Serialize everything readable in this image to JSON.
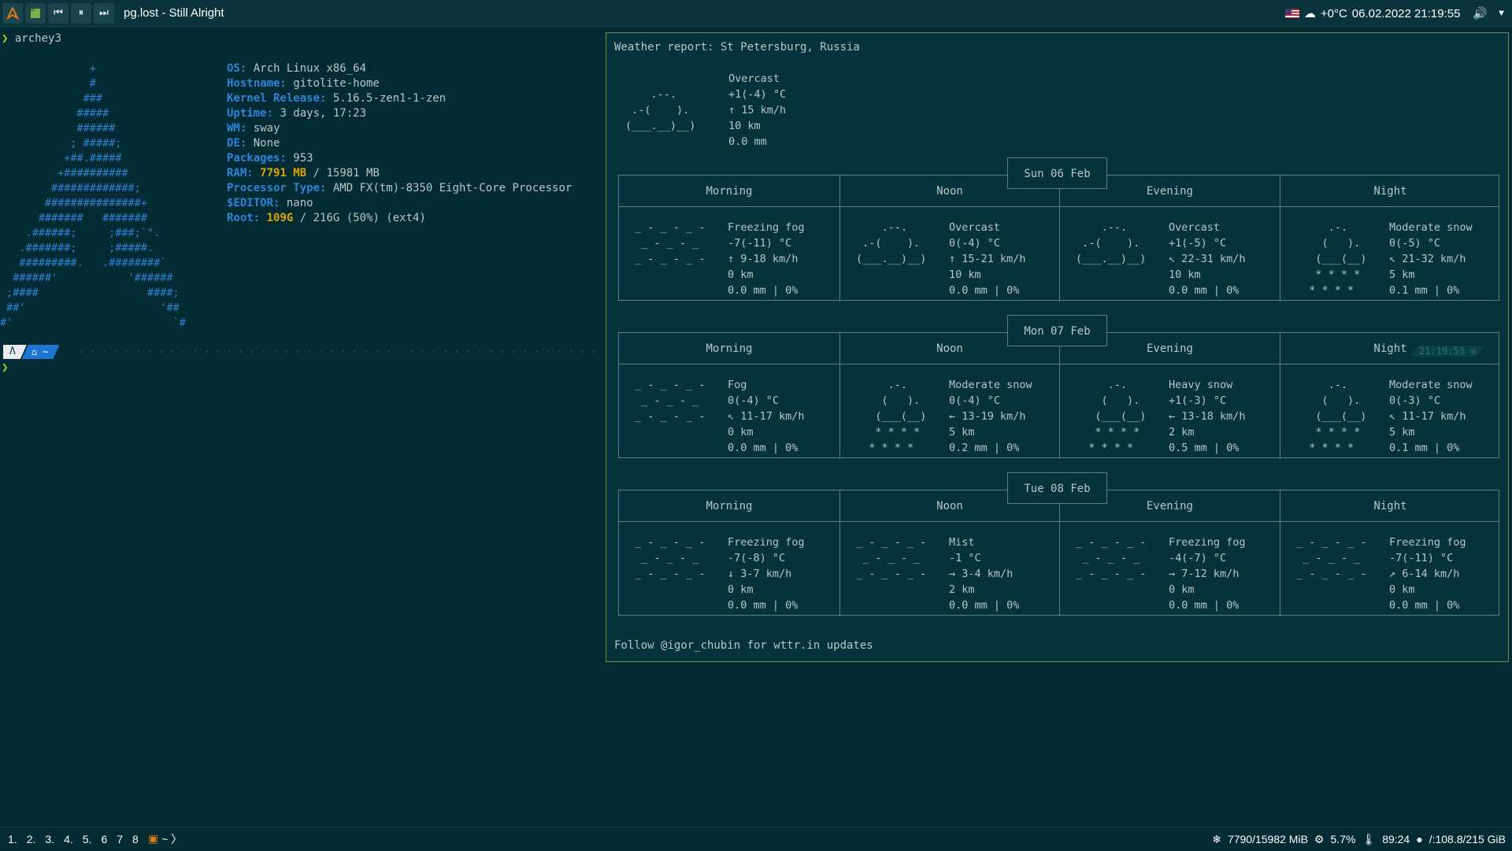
{
  "topbar": {
    "controls": [
      "prev",
      "pause",
      "next"
    ],
    "track": "pg.lost - Still Alright",
    "weather": "+0°C",
    "datetime": "06.02.2022 21:19:55",
    "icons": [
      "arch-icon",
      "file-manager-icon",
      "prev-icon",
      "pause-icon",
      "next-icon",
      "flag-icon",
      "weather-icon",
      "volume-icon",
      "chevron-down-icon"
    ]
  },
  "terminal": {
    "prompt": "❯",
    "command": "archey3",
    "info": [
      {
        "key": "OS:",
        "value": " Arch Linux x86_64"
      },
      {
        "key": "Hostname:",
        "value": " gitolite-home"
      },
      {
        "key": "Kernel Release:",
        "value": " 5.16.5-zen1-1-zen"
      },
      {
        "key": "Uptime:",
        "value": " 3 days, 17:23"
      },
      {
        "key": "WM:",
        "value": " sway"
      },
      {
        "key": "DE:",
        "value": " None"
      },
      {
        "key": "Packages:",
        "value": " 953"
      }
    ],
    "ram_key": "RAM:",
    "ram_used": "7791 MB",
    "ram_total": " / 15981 MB",
    "processor_key": "Processor Type:",
    "processor": " AMD FX(tm)-8350 Eight-Core Processor",
    "editor_key": "$EDITOR:",
    "editor": " nano",
    "root_key": "Root:",
    "root_used": "109G",
    "root_rest": " / 216G (50%) (ext4)",
    "logo": "              +\n              #\n             ###\n            #####\n            ######\n           ; #####;\n          +##.#####\n         +##########\n        #############;\n       ###############+\n      #######   #######\n    .######;     ;###;`\".\n   .#######;     ;#####.\n   #########.   .########`\n  ######'           '######\n ;####                 ####;\n ##'                     '##\n#'                         `#",
    "prompt_seg1": "Λ",
    "prompt_seg2": "⌂ ~",
    "cursor": "❯",
    "ghost_time": "21:19:53 ⊙"
  },
  "weather": {
    "title": "Weather report: St Petersburg, Russia",
    "current": {
      "art": "    .--.\n .-(    ).\n(___.__)__)",
      "lines": "Overcast\n+1(-4) °C\n↑ 15 km/h\n10 km\n0.0 mm"
    },
    "columns": [
      "Morning",
      "Noon",
      "Evening",
      "Night"
    ],
    "days": [
      {
        "label": "Sun 06 Feb",
        "cells": [
          {
            "art": "_ - _ - _ -\n _ - _ - _\n_ - _ - _ -",
            "text": "Freezing fog\n-7(-11) °C\n↑ 9-18 km/h\n0 km\n0.0 mm | 0%"
          },
          {
            "art": "    .--.\n .-(    ).\n(___.__)__)",
            "text": "Overcast\n0(-4) °C\n↑ 15-21 km/h\n10 km\n0.0 mm | 0%"
          },
          {
            "art": "    .--.\n .-(    ).\n(___.__)__)",
            "text": "Overcast\n+1(-5) °C\n↖ 22-31 km/h\n10 km\n0.0 mm | 0%"
          },
          {
            "art": "     .-.\n    (   ).\n   (___(__)\n   * * * *\n  * * * *",
            "text": "Moderate snow\n0(-5) °C\n↖ 21-32 km/h\n5 km\n0.1 mm | 0%"
          }
        ]
      },
      {
        "label": "Mon 07 Feb",
        "cells": [
          {
            "art": "_ - _ - _ -\n _ - _ - _\n_ - _ - _ -",
            "text": "Fog\n0(-4) °C\n↖ 11-17 km/h\n0 km\n0.0 mm | 0%"
          },
          {
            "art": "     .-.\n    (   ).\n   (___(__)\n   * * * *\n  * * * *",
            "text": "Moderate snow\n0(-4) °C\n← 13-19 km/h\n5 km\n0.2 mm | 0%"
          },
          {
            "art": "     .-.\n    (   ).\n   (___(__)\n   * * * *\n  * * * *",
            "text": "Heavy snow\n+1(-3) °C\n← 13-18 km/h\n2 km\n0.5 mm | 0%"
          },
          {
            "art": "     .-.\n    (   ).\n   (___(__)\n   * * * *\n  * * * *",
            "text": "Moderate snow\n0(-3) °C\n↖ 11-17 km/h\n5 km\n0.1 mm | 0%"
          }
        ]
      },
      {
        "label": "Tue 08 Feb",
        "cells": [
          {
            "art": "_ - _ - _ -\n _ - _ - _\n_ - _ - _ -",
            "text": "Freezing fog\n-7(-8) °C\n↓ 3-7 km/h\n0 km\n0.0 mm | 0%"
          },
          {
            "art": "_ - _ - _ -\n _ - _ - _\n_ - _ - _ -",
            "text": "Mist\n-1 °C\n→ 3-4 km/h\n2 km\n0.0 mm | 0%"
          },
          {
            "art": "_ - _ - _ -\n _ - _ - _\n_ - _ - _ -",
            "text": "Freezing fog\n-4(-7) °C\n→ 7-12 km/h\n0 km\n0.0 mm | 0%"
          },
          {
            "art": "_ - _ - _ -\n _ - _ - _\n_ - _ - _ -",
            "text": "Freezing fog\n-7(-11) °C\n↗ 6-14 km/h\n0 km\n0.0 mm | 0%"
          }
        ]
      }
    ],
    "follow": "Follow @igor_chubin for wttr.in updates"
  },
  "bottombar": {
    "workspaces": [
      "1.",
      "2.",
      "3.",
      "4.",
      "5.",
      "6",
      "7",
      "8"
    ],
    "active_app": "~ 〉",
    "memory": "7790/15982 MiB",
    "cpu": "5.7%",
    "temp": "89:24",
    "disk": "/:108.8/215 GiB"
  }
}
